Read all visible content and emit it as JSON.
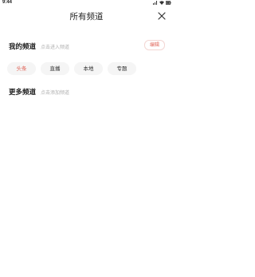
{
  "status_bar": {
    "time": "9:44"
  },
  "header": {
    "title": "所有频道",
    "close_icon": "close-icon"
  },
  "my_channels": {
    "title": "我的频道",
    "hint": "点击进入频道",
    "edit_label": "编辑",
    "items": [
      {
        "label": "头条",
        "active": true
      },
      {
        "label": "直播",
        "active": false
      },
      {
        "label": "本地",
        "active": false
      },
      {
        "label": "专题",
        "active": false
      }
    ]
  },
  "more_channels": {
    "title": "更多频道",
    "hint": "点击添加频道"
  },
  "colors": {
    "accent": "#e0665a",
    "chip_bg": "#f5f5f5",
    "hint_text": "#b0b0b0"
  }
}
